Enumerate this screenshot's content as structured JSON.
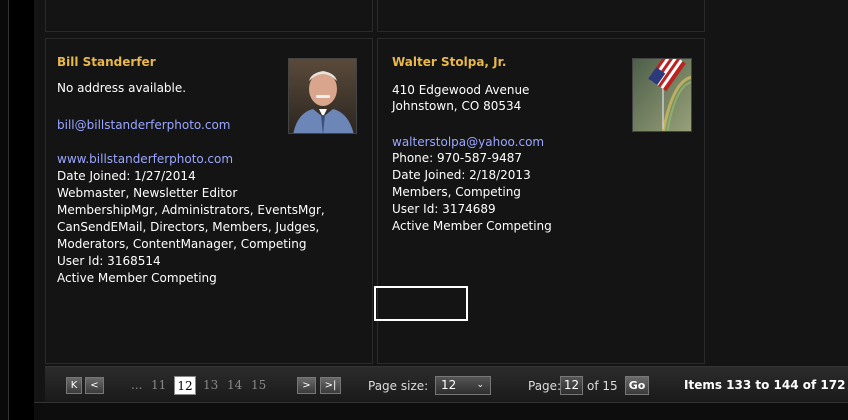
{
  "members": [
    {
      "name": "Bill Standerfer",
      "address_lines": [
        "No address available."
      ],
      "email": "bill@billstanderferphoto.com",
      "website": "www.billstanderferphoto.com",
      "date_joined": "Date Joined: 1/27/2014",
      "roles_lines": [
        "Webmaster, Newsletter Editor",
        "MembershipMgr, Administrators, EventsMgr,",
        "CanSendEMail, Directors, Members, Judges,",
        "Moderators, ContentManager, Competing"
      ],
      "user_id": "User Id: 3168514",
      "status": "Active Member Competing",
      "photo_icon": "portrait-photo"
    },
    {
      "name": "Walter Stolpa, Jr.",
      "address_lines": [
        "410 Edgewood Avenue",
        "Johnstown, CO 80534"
      ],
      "email": "walterstolpa@yahoo.com",
      "phone": "Phone: 970-587-9487",
      "date_joined": "Date Joined: 2/18/2013",
      "roles_lines": [
        "Members, Competing"
      ],
      "user_id": "User Id: 3174689",
      "status": "Active Member Competing",
      "photo_icon": "flag-rainbow-photo"
    }
  ],
  "pager": {
    "first_label": "K",
    "prev_label": "<",
    "ellipsis": "...",
    "pages": [
      "11",
      "12",
      "13",
      "14",
      "15"
    ],
    "current_page": "12",
    "next_label": ">",
    "last_label": ">|",
    "page_size_label": "Page size:",
    "page_size_value": "12",
    "page_label": "Page:",
    "page_value": "12",
    "of_label": "of 15",
    "go_label": "Go",
    "items_text": "Items 133 to 144 of 172"
  },
  "colors": {
    "name": "#e8b84a",
    "link": "#9aa6ff",
    "background": "#141414"
  }
}
